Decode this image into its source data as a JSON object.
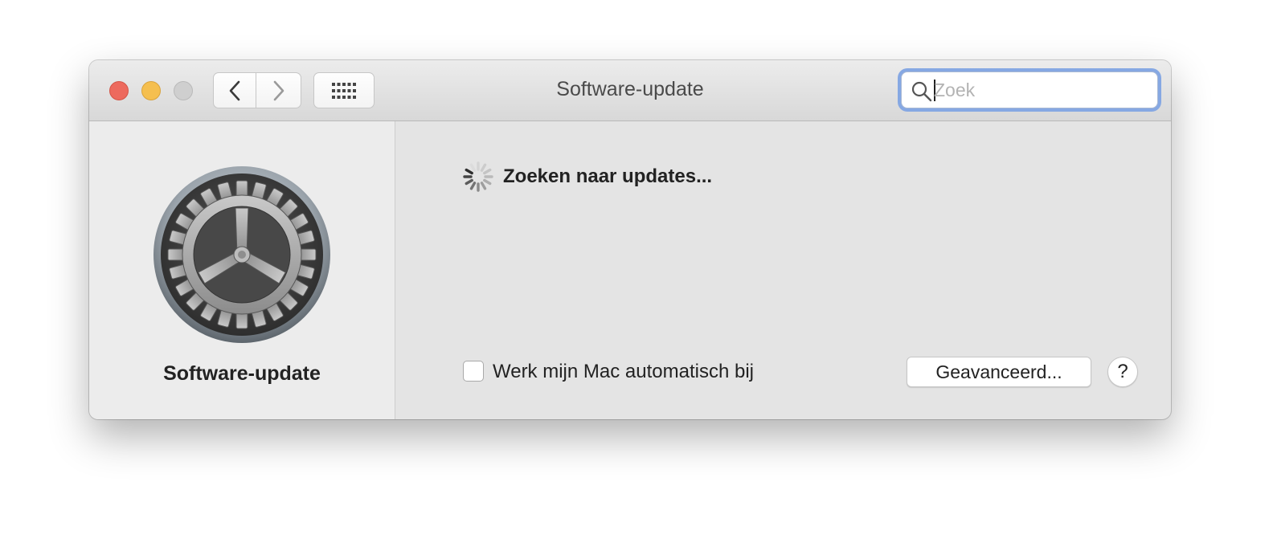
{
  "window": {
    "title": "Software-update"
  },
  "toolbar": {
    "back_icon": "chevron-left-icon",
    "forward_icon": "chevron-right-icon",
    "show_all_icon": "grid-icon"
  },
  "search": {
    "placeholder": "Zoek",
    "value": "",
    "icon": "search-icon"
  },
  "sidebar": {
    "icon": "software-update-gear-icon",
    "label": "Software-update"
  },
  "main": {
    "status_text": "Zoeken naar updates...",
    "auto_update_label": "Werk mijn Mac automatisch bij",
    "auto_update_checked": false,
    "advanced_button": "Geavanceerd...",
    "help_button": "?"
  },
  "colors": {
    "close": "#ed6a5e",
    "minimize": "#f5bf4f",
    "zoom_disabled": "#cfcfcf",
    "focus_ring": "#86a8e3"
  }
}
